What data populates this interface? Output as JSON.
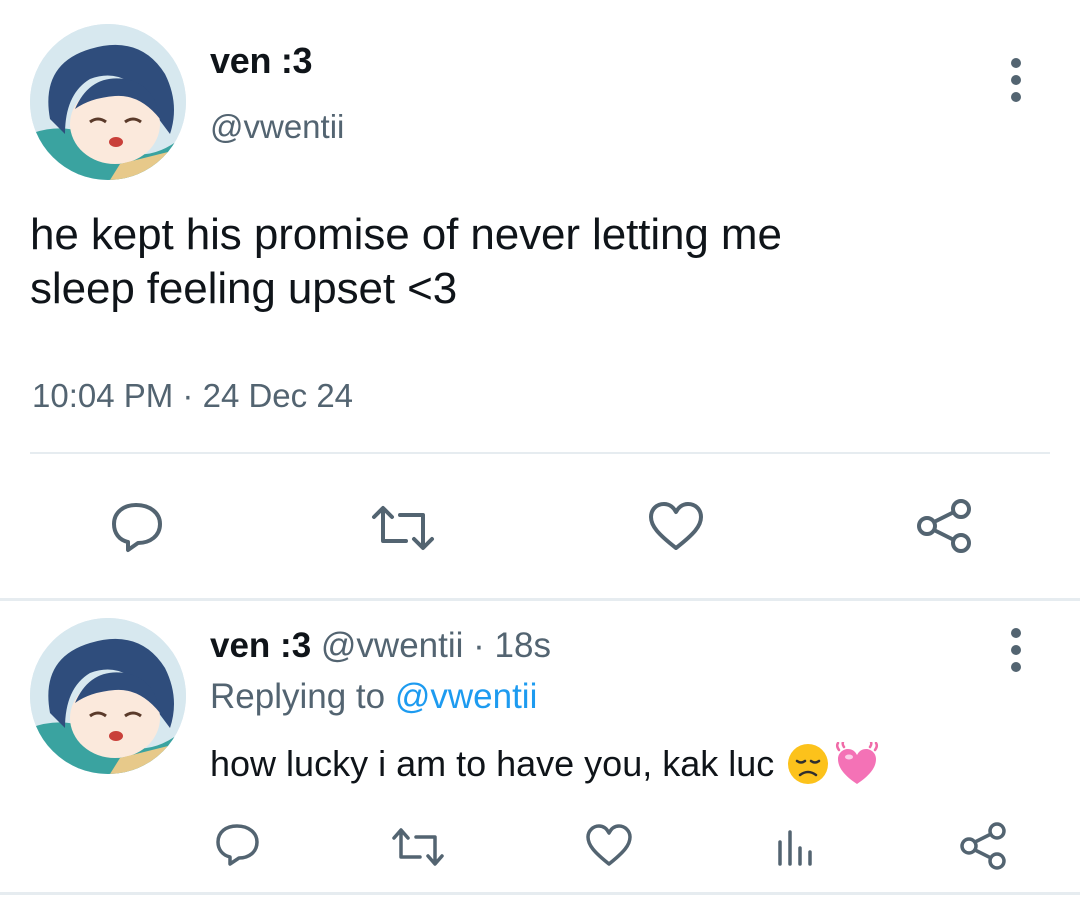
{
  "tweet": {
    "author_name": "ven :3",
    "author_handle": "@vwentii",
    "text_line1": "he kept his promise of never letting me",
    "text_line2": "sleep feeling upset <3",
    "time": "10:04 PM",
    "date": "24 Dec 24",
    "separator": "·",
    "actions": [
      "reply-icon",
      "retweet-icon",
      "like-icon",
      "share-icon"
    ]
  },
  "reply": {
    "author_name": "ven :3",
    "author_handle": "@vwentii",
    "separator": "·",
    "age": "18s",
    "replying_prefix": "Replying to",
    "replying_to": "@vwentii",
    "text": "how lucky i am to have you, kak luc",
    "emojis": [
      "disappointed-face-emoji",
      "beating-heart-emoji"
    ],
    "actions": [
      "reply-icon",
      "retweet-icon",
      "like-icon",
      "views-icon",
      "share-icon"
    ]
  },
  "colors": {
    "text": "#0f1419",
    "secondary": "#536471",
    "link": "#1d9bf0",
    "divider": "#e6ecf0"
  }
}
